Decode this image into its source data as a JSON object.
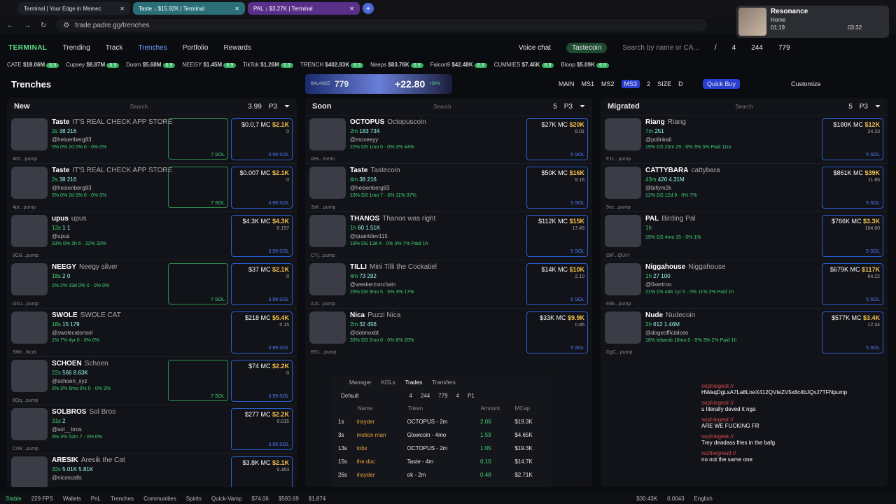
{
  "browser": {
    "tabs": [
      {
        "title": "Terminal | Your Edge in Memec"
      },
      {
        "title": "Taste ↓ $15.92K | Terminal"
      },
      {
        "title": "PAL ↓ $3.27K | Terminal"
      }
    ],
    "url": "trade.padre.gg/trenches"
  },
  "media": {
    "title": "Resonance",
    "subtitle": "Home",
    "elapsed": "01:19",
    "total": "03:32"
  },
  "nav": {
    "brand": "TERMINAL",
    "items": [
      "Trending",
      "Track",
      "Trenches",
      "Portfolio",
      "Rewards"
    ],
    "voice": "Voice chat",
    "coin": "Tastecoin",
    "search_placeholder": "Search by name or CA...",
    "slash": "/",
    "c1": "4",
    "c2": "244",
    "c3": "779"
  },
  "ticker": [
    {
      "n": "CATE",
      "v": "$18.06M"
    },
    {
      "n": "Cupsey",
      "v": "$8.87M"
    },
    {
      "n": "Doom",
      "v": "$5.68M"
    },
    {
      "n": "NEEGY",
      "v": "$1.45M"
    },
    {
      "n": "TikTok",
      "v": "$1.26M"
    },
    {
      "n": "TRENCH",
      "v": "$402.83K"
    },
    {
      "n": "Neeps",
      "v": "$83.76K"
    },
    {
      "n": "Falcon9",
      "v": "$42.48K"
    },
    {
      "n": "CUMMIES",
      "v": "$7.46K"
    },
    {
      "n": "Bloop",
      "v": "$5.09K"
    }
  ],
  "ticker_chip": "6.9",
  "sub": {
    "title": "Trenches",
    "balance_label": "BALANCE",
    "balance": "779",
    "pnl": "+22.80",
    "pnl_pct": "+30%",
    "modes": [
      "MAIN",
      "MS1",
      "MS2",
      "MS3",
      "2",
      "SIZE",
      "D"
    ],
    "quick": "Quick Buy",
    "customize": "Customize"
  },
  "cols": [
    {
      "title": "New",
      "search": "Search",
      "amount": "3.99",
      "preset": "P3"
    },
    {
      "title": "Soon",
      "search": "Search",
      "amount": "5",
      "preset": "P3",
      "pct": "%",
      "mc": "MC"
    },
    {
      "title": "Migrated",
      "search": "Search",
      "amount": "5",
      "preset": "P3"
    }
  ],
  "new_cards": [
    {
      "name": "Taste",
      "desc": "IT'S REAL CHECK APP STORE",
      "age": "2s",
      "h": "@heisenberg83",
      "s1": "38",
      "s2": "216",
      "ca": "462...pump",
      "v": "$0.0,7",
      "mc": "$2.1K",
      "f": "0",
      "sol": "3.99 SOL",
      "gsol": "7 SOL",
      "st": "0% 0% 2d 0% 0 · 0% 0%"
    },
    {
      "name": "Taste",
      "desc": "IT'S REAL CHECK APP STORE",
      "age": "2s",
      "h": "@heisenberg83",
      "s1": "38",
      "s2": "216",
      "ca": "4pr...pump",
      "v": "$0.007",
      "mc": "$2.1K",
      "f": "0",
      "sol": "3.99 SOL",
      "gsol": "7 SOL",
      "st": "0% 0% 2d 0% 0 · 0% 0%"
    },
    {
      "name": "upus",
      "desc": "upus",
      "age": "13s",
      "h": "@upus",
      "s1": "1",
      "s2": "1",
      "ca": "8CB...pump",
      "v": "$4.3K",
      "mc": "$4.3K",
      "f": "0.197",
      "sol": "3.99 SOL",
      "gsol": "",
      "st": "33% 0% 1h 6 · 32% 32%"
    },
    {
      "name": "NEEGY",
      "desc": "Neegy silver",
      "age": "18s",
      "h": "",
      "s1": "2",
      "s2": "0",
      "ca": "GkU...pump",
      "v": "$37",
      "mc": "$2.1K",
      "f": "0",
      "sol": "3.99 SOL",
      "gsol": "7 SOL",
      "st": "2% 2% 19d 0% 0 · 0% 0%"
    },
    {
      "name": "SWOLE",
      "desc": "SWOLE CAT",
      "age": "18s",
      "h": "@swolecatonsol",
      "s1": "15",
      "s2": "179",
      "ca": "SWr...Ncat",
      "v": "$218",
      "mc": "$5.4K",
      "f": "0.15",
      "sol": "3.99 SOL",
      "gsol": "",
      "st": "1% 7% 4yr 0 · 0% 0%"
    },
    {
      "name": "SCHOEN",
      "desc": "Schoen",
      "age": "22s",
      "h": "@schoen_xyz",
      "s1": "566",
      "s2": "8.63K",
      "ca": "8Qq...pump",
      "v": "$74",
      "mc": "$2.2K",
      "f": "0",
      "sol": "3.99 SOL",
      "gsol": "7 SOL",
      "st": "3% 3% 6mo 0% 0 · 0% 3%"
    },
    {
      "name": "SOLBROS",
      "desc": "Sol Bros",
      "age": "31s",
      "h": "@sol__bros",
      "s1": "2",
      "s2": "",
      "ca": "CrW...pump",
      "v": "$277",
      "mc": "$2.2K",
      "f": "0.015",
      "sol": "3.99 SOL",
      "gsol": "",
      "st": "3% 3% 52m 7 · 0% 0%"
    },
    {
      "name": "ARESIK",
      "desc": "Aresik the Cat",
      "age": "32s",
      "h": "@nicoscalls",
      "s1": "5.01K",
      "s2": "5.81K",
      "ca": "",
      "v": "$3.8K",
      "mc": "$2.1K",
      "f": "0.363",
      "sol": "",
      "gsol": "",
      "st": ""
    }
  ],
  "soon_cards": [
    {
      "name": "OCTOPUS",
      "desc": "Octopuscoin",
      "age": "2m",
      "h": "@moxeeyy",
      "s1": "183",
      "s2": "734",
      "ca": "A9s...Ke3n",
      "v": "$27K",
      "mc": "$20K",
      "f": "8.01",
      "sol": "5 SOL",
      "st": "22% DS 1mo 0 · 0% 3% 44%"
    },
    {
      "name": "Taste",
      "desc": "Tastecoin",
      "age": "4m",
      "h": "@heisenberg83",
      "s1": "38",
      "s2": "216",
      "ca": "3sK...pump",
      "v": "$50K",
      "mc": "$16K",
      "f": "8.16",
      "sol": "5 SOL",
      "st": "19% DS 1mo 7 · 3% 11% 37%"
    },
    {
      "name": "THANOS",
      "desc": "Thanos was right",
      "age": "1h",
      "h": "@quantdev115",
      "s1": "60",
      "s2": "1.51K",
      "ca": "CYj...pump",
      "v": "$112K",
      "mc": "$15K",
      "f": "17.45",
      "sol": "5 SOL",
      "st": "19% DS 13d 4 · 0% 3% 7% Paid 1h"
    },
    {
      "name": "TILLI",
      "desc": "Mini Tilli the Cockatiel",
      "age": "4m",
      "h": "@weskerzonchain",
      "s1": "73",
      "s2": "292",
      "ca": "AJc...pump",
      "v": "$14K",
      "mc": "$10K",
      "f": "2.10",
      "sol": "5 SOL",
      "st": "26% DS 9mo 5 · 5% 3% 17%"
    },
    {
      "name": "Nica",
      "desc": "Puzzi Nica",
      "age": "2m",
      "h": "@dotmoxbt",
      "s1": "32",
      "s2": "456",
      "ca": "BSL...pump",
      "v": "$33K",
      "mc": "$9.9K",
      "f": "0.86",
      "sol": "5 SOL",
      "st": "33% DS 2mo 0 · 0% 8% 20%"
    }
  ],
  "mig_cards": [
    {
      "name": "Riang",
      "desc": "Riang",
      "age": "7m",
      "h": "@polinkaii",
      "s1": "251",
      "s2": "",
      "ca": "F1c...pump",
      "v": "$180K",
      "mc": "$12K",
      "f": "24.33",
      "sol": "5 SOL",
      "st": "19% DS 23m 29 · 0% 3% 5% Paid 11m"
    },
    {
      "name": "CATTYBARA",
      "desc": "cattybara",
      "age": "43m",
      "h": "@billym2k",
      "s1": "420",
      "s2": "4.31M",
      "ca": "9oz...pump",
      "v": "$861K",
      "mc": "$39K",
      "f": "11.85",
      "sol": "5 SOL",
      "st": "12% DS 12d 9 · 0% 7%"
    },
    {
      "name": "PAL",
      "desc": "Birding Pal",
      "age": "1h",
      "h": "",
      "s1": "",
      "s2": "",
      "ca": "DtF...QUrY",
      "v": "$766K",
      "mc": "$3.3K",
      "f": "104.60",
      "sol": "5 SOL",
      "st": "19% DS 4mo 15 · 0% 1%"
    },
    {
      "name": "Niggahouse",
      "desc": "Niggahouse",
      "age": "1h",
      "h": "@0xertroo",
      "s1": "27",
      "s2": "100",
      "ca": "6Sk...pump",
      "v": "$679K",
      "mc": "$117K",
      "f": "64.22",
      "sol": "5 SOL",
      "st": "21% DS ott4 1yr 5 · 0% 11% 2% Paid 1h"
    },
    {
      "name": "Nude",
      "desc": "Nudecoin",
      "age": "2h",
      "h": "@dogeofficialceo",
      "s1": "612",
      "s2": "1.46M",
      "ca": "DgC...pump",
      "v": "$577K",
      "mc": "$3.4K",
      "f": "12.34",
      "sol": "5 SOL",
      "st": "18% lebamb 10mo 0 · 0% 3% 2% Paid 1h"
    }
  ],
  "trades": {
    "tabs": [
      "Manager",
      "KOLs",
      "Trades",
      "Transfers"
    ],
    "preset": "Default",
    "c1": "4",
    "c2": "244",
    "c3": "779",
    "amt": "4",
    "p": "P1",
    "headers": [
      "Name",
      "Token",
      "Amount",
      "MCap"
    ],
    "rows": [
      [
        "1s",
        "insyder",
        "OCTOPUS - 2m",
        "2.06",
        "$19.3K"
      ],
      [
        "3s",
        "motion man",
        "Glowcoin - 4mo",
        "1.59",
        "$4.65K"
      ],
      [
        "13s",
        "tobx",
        "OCTOPUS - 2m",
        "1.05",
        "$19.3K"
      ],
      [
        "15s",
        "the doc",
        "Taste - 4m",
        "0.10",
        "$14.7K"
      ],
      [
        "26s",
        "insyder",
        "ok - 2m",
        "0.48",
        "$2.71K"
      ]
    ]
  },
  "chat": [
    {
      "u": "sophiegeat //",
      "m": "HWaqDgLsA7La8LneX412QVteZV5x8c4bJQxJ7TFNpump"
    },
    {
      "u": "sophiegeat //",
      "m": "u literally deved it nga"
    },
    {
      "u": "sophiegeat //",
      "m": "ARE WE FUCKING FR"
    },
    {
      "u": "sophiegeat //",
      "m": "Trey deadass fries in the bafg"
    },
    {
      "u": "rezthegreatt //",
      "m": "no not the same one"
    }
  ],
  "status": {
    "conn": "Stable",
    "fps": "229 FPS",
    "items": [
      "Wallets",
      "PnL",
      "Trenches",
      "Communities",
      "Spirits",
      "Quick-Vamp"
    ],
    "p1": "$74.06",
    "p2": "$593.69",
    "p3": "$1,874",
    "mc": "$30.43K",
    "gas": "0.0043",
    "lang": "English"
  }
}
